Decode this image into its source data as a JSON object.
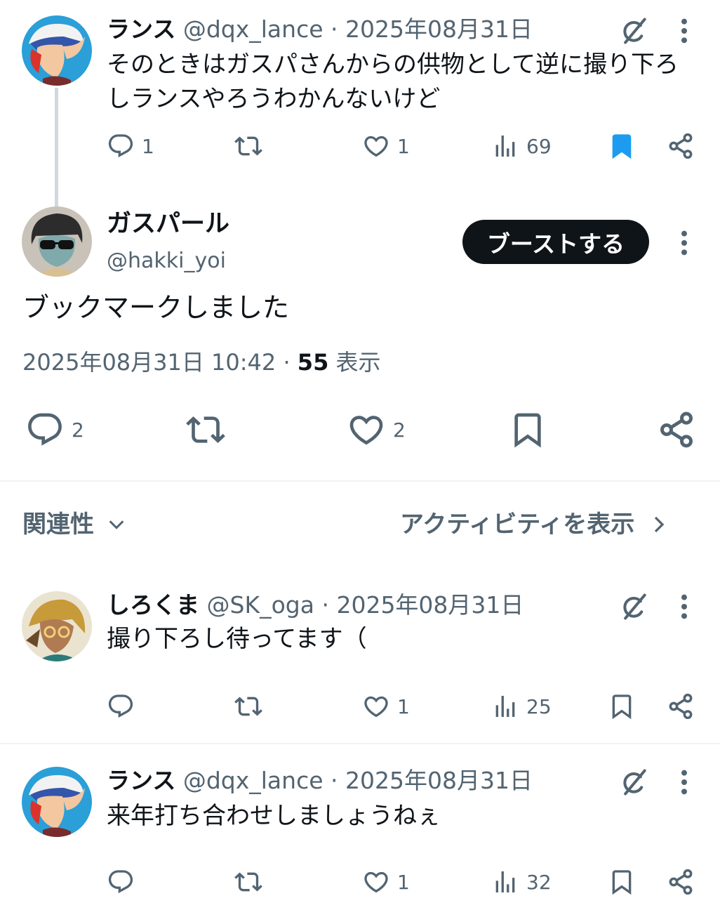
{
  "colors": {
    "text": "#0f1419",
    "muted": "#536471",
    "accent": "#1d9bf0",
    "divider": "#eff3f4"
  },
  "tweets_top": {
    "name": "ランス",
    "handle": "@dqx_lance",
    "dot": "·",
    "date": "2025年08月31日",
    "text": "そのときはガスパさんからの供物として逆に撮り下ろしランスやろうわかんないけど",
    "replies": "1",
    "likes": "1",
    "views": "69",
    "bookmarked": true
  },
  "main_tweet": {
    "name": "ガスパール",
    "handle": "@hakki_yoi",
    "follow_label": "ブーストする",
    "text": "ブックマークしました",
    "timestamp": "2025年08月31日 10:42",
    "dot": "·",
    "views_count": "55",
    "views_label": "表示",
    "replies": "2",
    "likes": "2"
  },
  "sort_bar": {
    "label": "関連性",
    "activity_label": "アクティビティを表示"
  },
  "replies": [
    {
      "name": "しろくま",
      "handle": "@SK_oga",
      "dot": "·",
      "date": "2025年08月31日",
      "text": "撮り下ろし待ってます（",
      "replies": "",
      "likes": "1",
      "views": "25"
    },
    {
      "name": "ランス",
      "handle": "@dqx_lance",
      "dot": "·",
      "date": "2025年08月31日",
      "text": "来年打ち合わせしましょうねぇ",
      "replies": "",
      "likes": "1",
      "views": "32"
    }
  ],
  "icons": [
    "reply-icon",
    "retweet-icon",
    "like-icon",
    "views-icon",
    "bookmark-icon",
    "share-icon",
    "grok-icon",
    "more-icon",
    "chevron-down-icon",
    "chevron-right-icon"
  ]
}
